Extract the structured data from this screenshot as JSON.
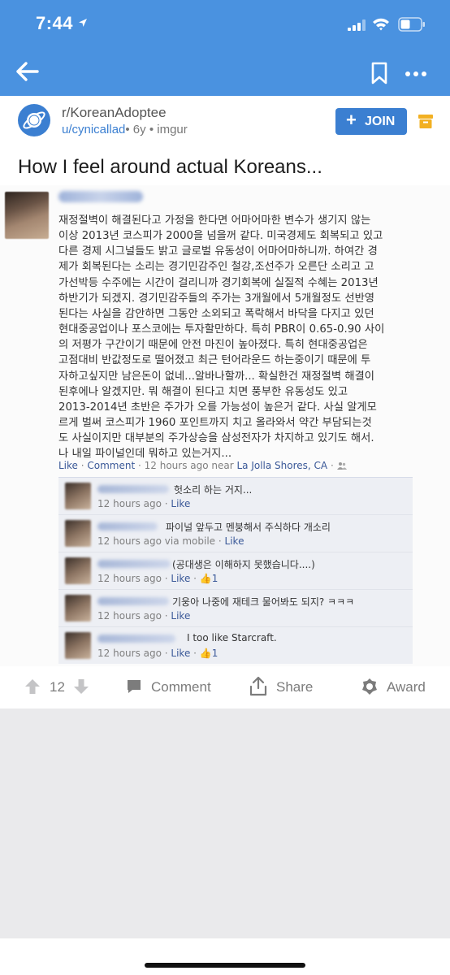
{
  "status": {
    "time": "7:44"
  },
  "post": {
    "subreddit": "r/KoreanAdoptee",
    "user": "u/cynicallad",
    "age": "• 6y • ",
    "source": "imgur",
    "join_label": "JOIN",
    "title": "How I feel around actual Koreans..."
  },
  "facebook": {
    "body": "재정절벽이 해결된다고 가정을 한다면 어마어마한 변수가 생기지 않는\n이상 2013년 코스피가 2000을 넘을꺼 같다. 미국경제도 회복되고 있고\n다른 경제 시그널들도 밝고 글로벌 유동성이 어마어마하니까. 하여간 경\n제가 회복된다는 소리는 경기민감주인 철강,조선주가 오른단 소리고 고\n가선박등 수주에는 시간이 걸리니까 경기회복에 실질적 수혜는 2013년\n하반기가 되겠지. 경기민감주들의 주가는 3개월에서 5개월정도 선반영\n된다는 사실을 감안하면 그동안 소외되고 폭락해서 바닥을 다지고 있던\n현대중공업이나 포스코에는 투자할만하다. 특히 PBR이 0.65-0.90 사이\n의 저평가 구간이기 때문에 안전 마진이 높아졌다. 특히 현대중공업은\n고점대비 반값정도로 떨어졌고 최근 턴어라운드 하는중이기 때문에 투\n자하고싶지만 남은돈이 없네...알바나할까... 확실한건 재정절벽 해결이\n된후에나 알겠지만. 뭐 해결이 된다고 치면 풍부한 유동성도 있고\n2013-2014년 초반은 주가가 오를 가능성이 높은거 같다. 사실 알게모\n르게 벌써 코스피가 1960 포인트까지 치고 올라와서 약간 부담되는것\n도 사실이지만 대부분의 주가상승을 삼성전자가 차지하고 있기도 해서.\n나 내일 파이널인데 뭐하고 있는거지...",
    "like": "Like",
    "sep": " · ",
    "comment": "Comment",
    "when": " · 12 hours ago near ",
    "place": "La Jolla Shores, CA",
    "tail": " · ",
    "comments": [
      {
        "text": "헛소리 하는 거지...",
        "time": "12 hours ago",
        "like": "Like",
        "count": ""
      },
      {
        "text": "파이널 앞두고 멘붕해서 주식하다 개소리",
        "time": "12 hours ago via mobile",
        "like": "Like",
        "count": ""
      },
      {
        "text": "(공대생은 이해하지 못했습니다....)",
        "time": "12 hours ago",
        "like": "Like",
        "count": "1"
      },
      {
        "text": "기웅아 나중에 재테크 물어봐도 되지? ㅋㅋㅋ",
        "time": "12 hours ago",
        "like": "Like",
        "count": ""
      },
      {
        "text": "I too like Starcraft.",
        "time": "12 hours ago",
        "like": "Like",
        "count": "1"
      }
    ]
  },
  "actions": {
    "score": "12",
    "comment": "Comment",
    "share": "Share",
    "award": "Award"
  },
  "colors": {
    "topbar": "#4a92e0",
    "accent": "#3b7fd1",
    "archive": "#f2b022",
    "fb_link": "#3b5998"
  }
}
